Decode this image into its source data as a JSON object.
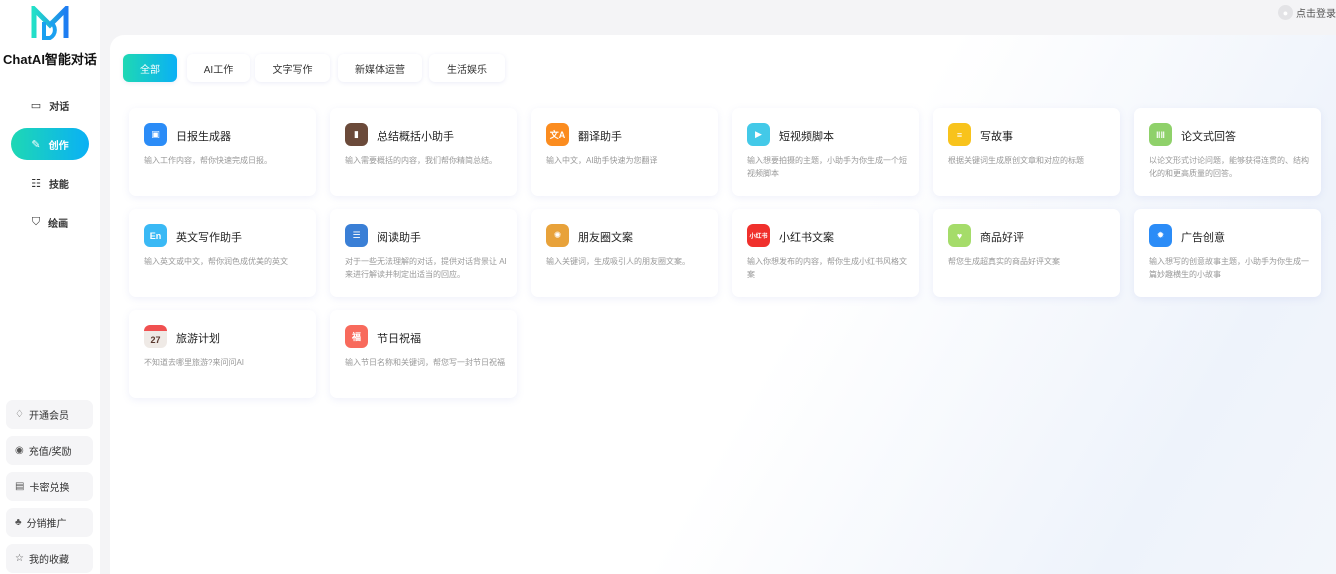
{
  "app": {
    "brand": "ChatAI智能对话",
    "login": "点击登录"
  },
  "colors": {
    "accent_start": "#1ed8b4",
    "accent_end": "#0ab0f5"
  },
  "sidebar": {
    "nav": [
      {
        "label": "对话",
        "icon": "chat-icon"
      },
      {
        "label": "创作",
        "icon": "pen-icon",
        "active": true
      },
      {
        "label": "技能",
        "icon": "list-icon"
      },
      {
        "label": "绘画",
        "icon": "brush-icon"
      }
    ],
    "bottom": [
      {
        "label": "开通会员",
        "icon": "diamond-icon"
      },
      {
        "label": "充值/奖励",
        "icon": "coin-icon"
      },
      {
        "label": "卡密兑换",
        "icon": "card-icon"
      },
      {
        "label": "分销推广",
        "icon": "share-icon"
      },
      {
        "label": "我的收藏",
        "icon": "star-icon"
      }
    ]
  },
  "tabs": [
    {
      "label": "全部",
      "active": true
    },
    {
      "label": "AI工作"
    },
    {
      "label": "文字写作"
    },
    {
      "label": "新媒体运营"
    },
    {
      "label": "生活娱乐"
    }
  ],
  "cards": [
    {
      "title": "日报生成器",
      "desc": "输入工作内容，帮你快速完成日报。",
      "icon": "calendar-report-icon",
      "color": "#2b8cf7",
      "glyph": "▣"
    },
    {
      "title": "总结概括小助手",
      "desc": "输入需要概括的内容，我们帮你精简总结。",
      "icon": "briefcase-icon",
      "color": "#6b4a3a",
      "glyph": "▮"
    },
    {
      "title": "翻译助手",
      "desc": "输入中文，AI助手快速为您翻译",
      "icon": "translate-icon",
      "color": "#fb8c1f",
      "glyph": "文A"
    },
    {
      "title": "短视频脚本",
      "desc": "输入想要拍摄的主题，小助手为你生成一个短视频脚本",
      "icon": "clapperboard-icon",
      "color": "#43c9e8",
      "glyph": "▶"
    },
    {
      "title": "写故事",
      "desc": "根据关键词生成原创文章和对应的标题",
      "icon": "notepad-pencil-icon",
      "color": "#f8c31c",
      "glyph": "≡"
    },
    {
      "title": "论文式回答",
      "desc": "以论文形式讨论问题，能够获得连贯的、结构化的和更高质量的回答。",
      "icon": "binders-icon",
      "color": "#8fd16a",
      "glyph": "‖‖"
    },
    {
      "title": "英文写作助手",
      "desc": "输入英文或中文，帮你润色成优美的英文",
      "icon": "english-icon",
      "color": "#3ab9f5",
      "glyph": "En"
    },
    {
      "title": "阅读助手",
      "desc": "对于一些无法理解的对话，提供对话背景让 AI 来进行解读并制定出适当的回应。",
      "icon": "books-icon",
      "color": "#3a7fd6",
      "glyph": "☰"
    },
    {
      "title": "朋友圈文案",
      "desc": "输入关键词，生成吸引人的朋友圈文案。",
      "icon": "aperture-icon",
      "color": "#e8a23a",
      "glyph": "✺"
    },
    {
      "title": "小红书文案",
      "desc": "输入你想发布的内容，帮你生成小红书风格文案",
      "icon": "xiaohongshu-icon",
      "color": "#f0302c",
      "glyph": "小红书"
    },
    {
      "title": "商品好评",
      "desc": "帮您生成超真实的商品好评文案",
      "icon": "shopping-bag-icon",
      "color": "#a5dc6a",
      "glyph": "♥"
    },
    {
      "title": "广告创意",
      "desc": "输入想写的创意故事主题，小助手为你生成一篇妙趣横生的小故事",
      "icon": "lightbulb-icon",
      "color": "#2b8cf7",
      "glyph": "✹"
    },
    {
      "title": "旅游计划",
      "desc": "不知道去哪里旅游?来问问AI",
      "icon": "calendar-27-icon",
      "color": "#efeae6",
      "glyph": "27"
    },
    {
      "title": "节日祝福",
      "desc": "输入节日名称和关键词，帮您写一封节日祝福",
      "icon": "scroll-icon",
      "color": "#f86a5c",
      "glyph": "福"
    }
  ]
}
